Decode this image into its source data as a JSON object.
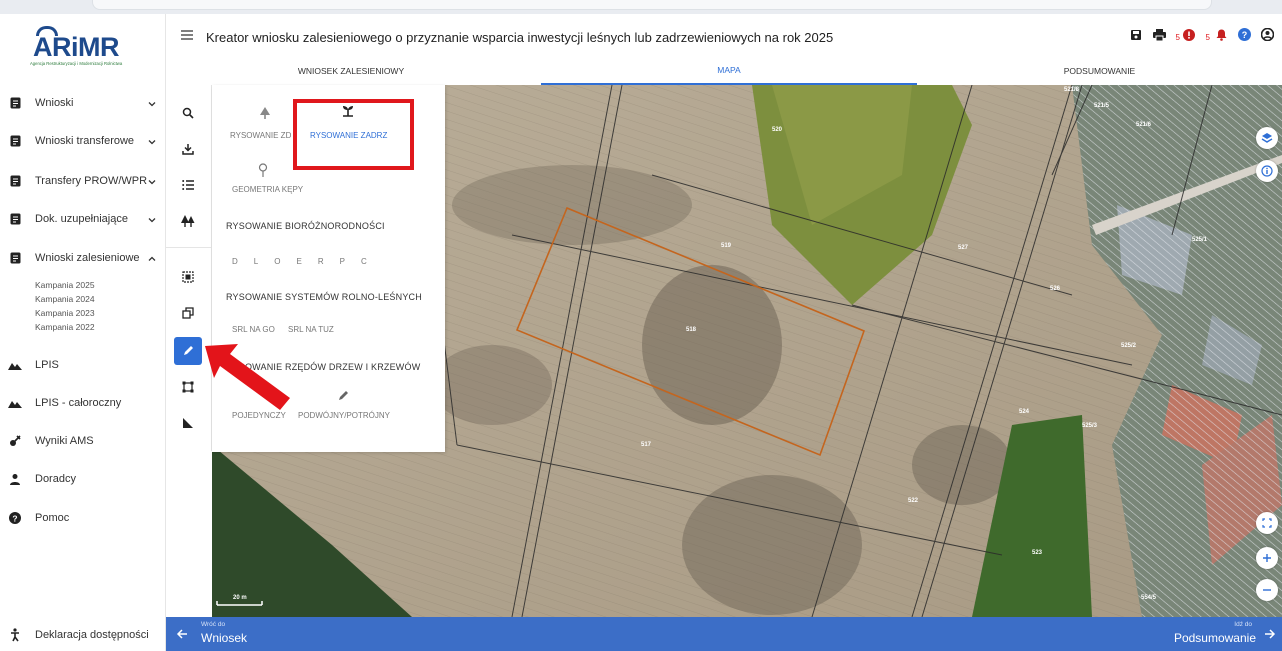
{
  "header": {
    "title": "Kreator wniosku zalesieniowego o przyznanie wsparcia inwestycji leśnych lub zadrzewieniowych na rok 2025",
    "badge_left": "5",
    "badge_right": "5"
  },
  "tabs": [
    {
      "label": "WNIOSEK ZALESIENIOWY",
      "active": false
    },
    {
      "label": "MAPA",
      "active": true
    },
    {
      "label": "PODSUMOWANIE",
      "active": false
    }
  ],
  "logo": {
    "name": "ARiMR",
    "subtitle": "Agencja Restrukturyzacji i Modernizacji Rolnictwa"
  },
  "sidebar": {
    "items": [
      {
        "label": "Wnioski",
        "icon": "document-icon",
        "expandable": true
      },
      {
        "label": "Wnioski transferowe",
        "icon": "document-icon",
        "expandable": true
      },
      {
        "label": "Transfery PROW/WPR",
        "icon": "document-icon",
        "expandable": true
      },
      {
        "label": "Dok. uzupełniające",
        "icon": "document-icon",
        "expandable": true
      },
      {
        "label": "Wnioski zalesieniowe",
        "icon": "document-icon",
        "expandable": true,
        "expanded": true
      },
      {
        "label": "LPIS",
        "icon": "mountain-icon"
      },
      {
        "label": "LPIS - całoroczny",
        "icon": "mountain-icon"
      },
      {
        "label": "Wyniki AMS",
        "icon": "satellite-icon"
      },
      {
        "label": "Doradcy",
        "icon": "person-icon"
      },
      {
        "label": "Pomoc",
        "icon": "help-icon"
      }
    ],
    "subitems": [
      "Kampania 2025",
      "Kampania 2024",
      "Kampania 2023",
      "Kampania 2022"
    ],
    "footer": "Deklaracja dostępności"
  },
  "draw_panel": {
    "drawing_zd": "RYSOWANIE ZD",
    "drawing_zadrz": "RYSOWANIE ZADRZ",
    "geometry_kepy": "GEOMETRIA KĘPY",
    "biodiversity_header": "RYSOWANIE BIORÓŻNORODNOŚCI",
    "biodiversity_letters": [
      "D",
      "L",
      "O",
      "E",
      "R",
      "P",
      "C"
    ],
    "agroforestry_header": "RYSOWANIE SYSTEMÓW ROLNO-LEŚNYCH",
    "srl_go": "SRL NA GO",
    "srl_tuz": "SRL NA TUZ",
    "rows_header": "RYSOWANIE RZĘDÓW DRZEW I KRZEWÓW",
    "single": "POJEDYNCZY",
    "double": "PODWÓJNY/POTRÓJNY"
  },
  "map": {
    "scale": "20 m",
    "parcels": [
      "521/8",
      "521/5",
      "521/6",
      "520",
      "519",
      "527",
      "526",
      "525/1",
      "518",
      "525/2",
      "524",
      "525/3",
      "517",
      "522",
      "523",
      "554/5"
    ]
  },
  "bottom_bar": {
    "back_small": "Wróć do",
    "back_big": "Wniosek",
    "next_small": "Idź do",
    "next_big": "Podsumowanie"
  },
  "colors": {
    "accent": "#2f6fd6",
    "bottom_bar": "#3c6ec7",
    "highlight": "#e0171c",
    "brand": "#1e4a8c"
  }
}
